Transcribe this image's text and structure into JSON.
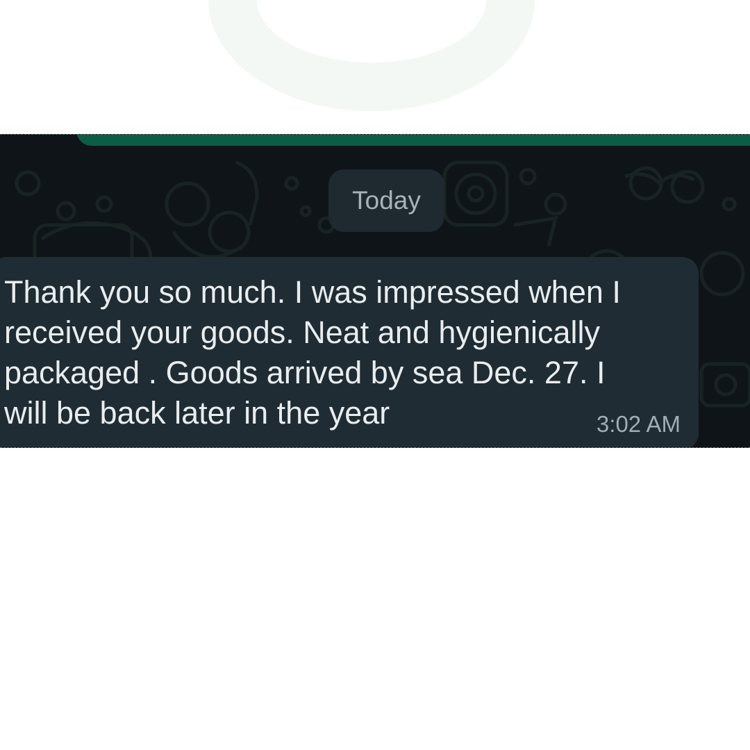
{
  "chat": {
    "date_separator": "Today",
    "message": {
      "text": "Thank you so much. I was impressed when I\nreceived your goods. Neat and hygienically\npackaged . Goods arrived by sea Dec. 27. I\nwill be back later in the year",
      "time": "3:02 AM"
    }
  },
  "colors": {
    "chat_background": "#0e1417",
    "bubble_incoming": "#1f2c33",
    "date_chip": "#1e2a30",
    "accent_bar": "#0b5d45",
    "message_text": "#e9edef",
    "meta_text": "#a2adb3"
  }
}
